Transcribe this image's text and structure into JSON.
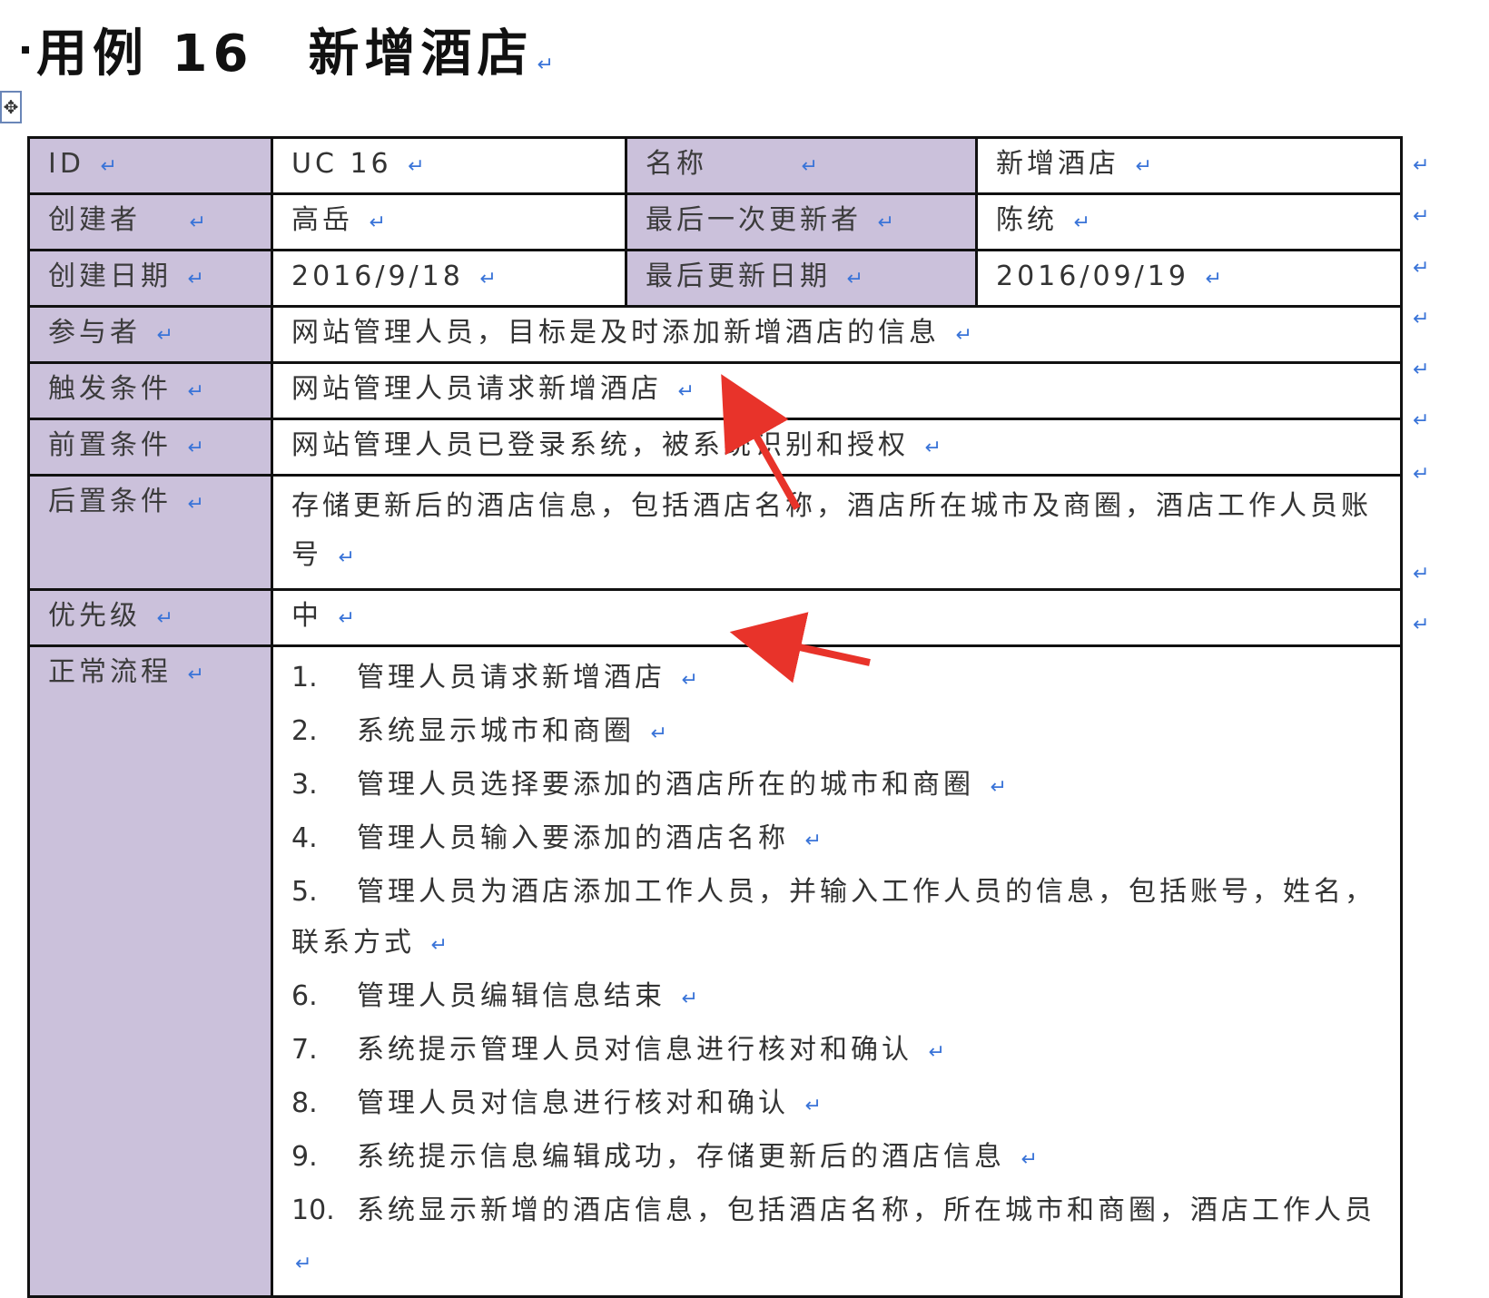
{
  "heading": {
    "prefix": "用例 16",
    "title": "新增酒店",
    "mark": "↵"
  },
  "move_handle": "✥",
  "para_mark": "↵",
  "table": {
    "id_label": "ID",
    "id_value": "UC 16",
    "name_label": "名称",
    "name_value": "新增酒店",
    "creator_label": "创建者",
    "creator_value": "高岳",
    "last_updater_label": "最后一次更新者",
    "last_updater_value": "陈统",
    "created_date_label": "创建日期",
    "created_date_value": "2016/9/18",
    "last_update_date_label": "最后更新日期",
    "last_update_date_value": "2016/09/19",
    "actor_label": "参与者",
    "actor_value": "网站管理人员，目标是及时添加新增酒店的信息",
    "trigger_label": "触发条件",
    "trigger_value": "网站管理人员请求新增酒店",
    "precondition_label": "前置条件",
    "precondition_value": "网站管理人员已登录系统，被系统识别和授权",
    "postcondition_label": "后置条件",
    "postcondition_value": "存储更新后的酒店信息，包括酒店名称，酒店所在城市及商圈，酒店工作人员账号",
    "priority_label": "优先级",
    "priority_value": "中",
    "flow_label": "正常流程",
    "flow_steps": [
      {
        "num": "1.",
        "text": "管理人员请求新增酒店"
      },
      {
        "num": "2.",
        "text": "系统显示城市和商圈"
      },
      {
        "num": "3.",
        "text": "管理人员选择要添加的酒店所在的城市和商圈"
      },
      {
        "num": "4.",
        "text": "管理人员输入要添加的酒店名称"
      },
      {
        "num": "5.",
        "text": "管理人员为酒店添加工作人员，并输入工作人员的信息，包括账号，姓名，联系方式"
      },
      {
        "num": "6.",
        "text": "管理人员编辑信息结束"
      },
      {
        "num": "7.",
        "text": "系统提示管理人员对信息进行核对和确认"
      },
      {
        "num": "8.",
        "text": "管理人员对信息进行核对和确认"
      },
      {
        "num": "9.",
        "text": "系统提示信息编辑成功，存储更新后的酒店信息"
      },
      {
        "num": "10.",
        "text": "系统显示新增的酒店信息，包括酒店名称，所在城市和商圈，酒店工作人员"
      }
    ]
  },
  "colors": {
    "label_bg": "#cbc1db",
    "border": "#111111",
    "para_mark": "#3a74d8",
    "arrow": "#e8332a"
  }
}
